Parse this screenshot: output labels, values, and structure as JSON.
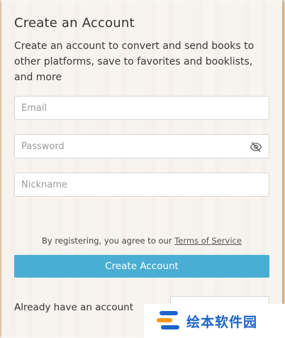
{
  "form": {
    "title": "Create an Account",
    "description": "Create an account to convert and send books to other platforms, save to favorites and booklists, and more",
    "email_placeholder": "Email",
    "password_placeholder": "Password",
    "nickname_placeholder": "Nickname",
    "terms_prefix": "By registering, you agree to our ",
    "terms_link": "Terms of Service",
    "submit_label": "Create Account",
    "already_text": "Already have an account"
  },
  "watermark": {
    "text": "绘本软件园"
  },
  "colors": {
    "accent": "#4aaed4",
    "watermark_blue": "#1d64c8",
    "watermark_orange": "#f39a1e"
  }
}
